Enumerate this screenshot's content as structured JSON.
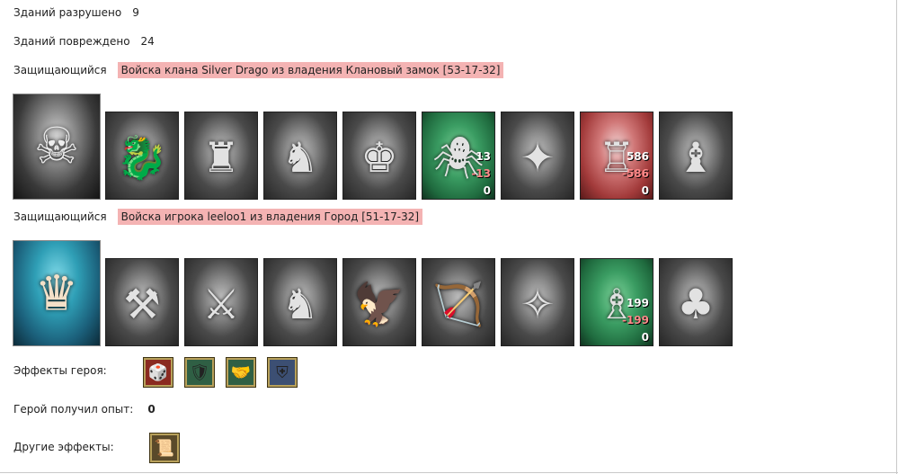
{
  "stats": {
    "destroyed_label": "Зданий разрушено",
    "destroyed_value": "9",
    "damaged_label": "Зданий повреждено",
    "damaged_value": "24"
  },
  "defender1": {
    "label": "Защищающийся",
    "title": "Войска клана Silver Drago из владения Клановый замок [53-17-32]",
    "hero_icon": "dark-lord-portrait-icon",
    "units": [
      {
        "icon": "hydra-icon",
        "state": "dead"
      },
      {
        "icon": "golem-icon",
        "state": "dead"
      },
      {
        "icon": "spearman-icon",
        "state": "dead"
      },
      {
        "icon": "gargoyle-icon",
        "state": "dead"
      },
      {
        "icon": "spider-icon",
        "state": "alive",
        "total": "13",
        "lost": "-13",
        "left": "0"
      },
      {
        "icon": "mage-icon",
        "state": "dead"
      },
      {
        "icon": "siege-tower-icon",
        "state": "alive",
        "total": "586",
        "lost": "-586",
        "left": "0"
      },
      {
        "icon": "demon-icon",
        "state": "dead"
      }
    ]
  },
  "defender2": {
    "label": "Защищающийся",
    "title": "Войска игрока leeloo1 из владения Город [51-17-32]",
    "hero_icon": "elf-heroine-portrait-icon",
    "units": [
      {
        "icon": "dwarf-icon",
        "state": "dead"
      },
      {
        "icon": "knight-icon",
        "state": "dead"
      },
      {
        "icon": "centaur-icon",
        "state": "dead"
      },
      {
        "icon": "griffin-icon",
        "state": "dead"
      },
      {
        "icon": "archer-icon",
        "state": "dead"
      },
      {
        "icon": "sorceress-icon",
        "state": "dead"
      },
      {
        "icon": "druid-icon",
        "state": "alive",
        "total": "199",
        "lost": "-199",
        "left": "0"
      },
      {
        "icon": "ent-icon",
        "state": "dead"
      }
    ]
  },
  "hero_effects": {
    "label": "Эффекты героя:",
    "icons": [
      "dice-hand-icon",
      "shield-icon",
      "handshake-shield-icon",
      "armor-icon"
    ]
  },
  "hero_xp": {
    "label": "Герой получил опыт:",
    "value": "0"
  },
  "other_effects": {
    "label": "Другие эффекты:",
    "icons": [
      "scroll-icon"
    ]
  }
}
